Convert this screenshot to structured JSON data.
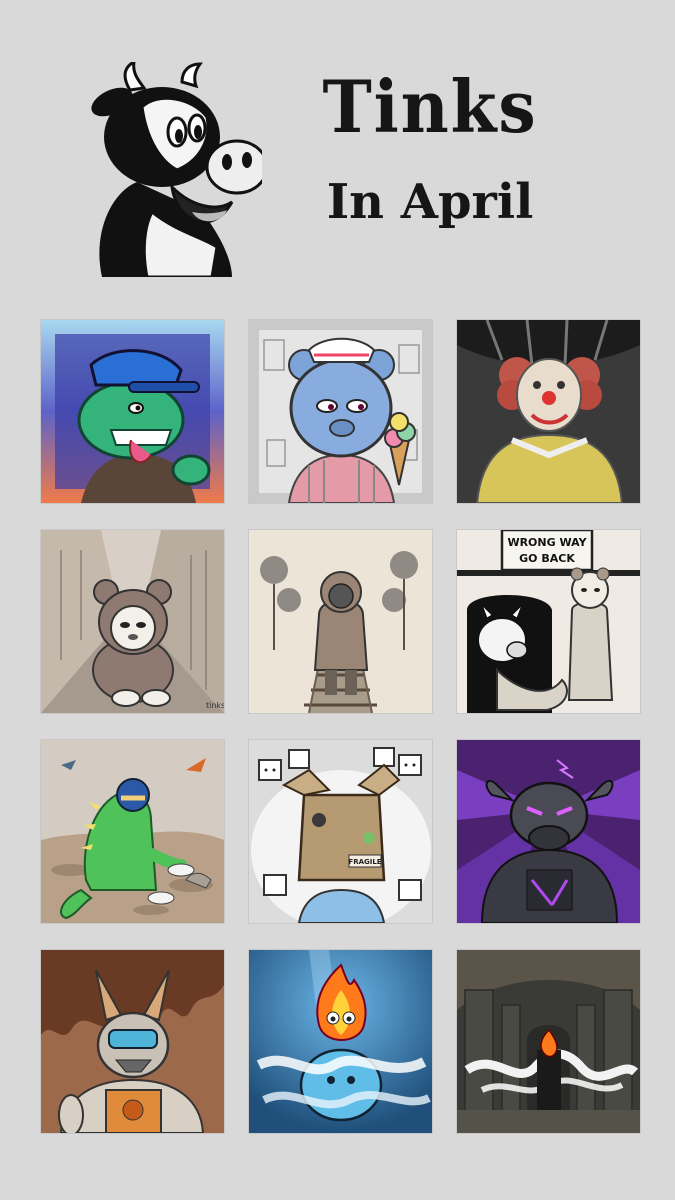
{
  "header": {
    "title": "Tinks",
    "subtitle": "In April"
  },
  "gallery": {
    "artworks": [
      {
        "subject": "green-dinosaur-blue-cap-icon"
      },
      {
        "subject": "blue-bear-ice-cream-icon"
      },
      {
        "subject": "clown-icon"
      },
      {
        "subject": "bear-hoodie-alley-icon"
      },
      {
        "subject": "hooded-figure-railroad-icon"
      },
      {
        "subject": "wrong-way-go-back-icon",
        "sign_text": "WRONG WAY GO BACK"
      },
      {
        "subject": "dinosaur-costume-desert-icon"
      },
      {
        "subject": "box-head-figure-icon",
        "box_label": "FRAGILE"
      },
      {
        "subject": "robot-bull-purple-icon"
      },
      {
        "subject": "rabbit-astronaut-icon"
      },
      {
        "subject": "fire-spirit-icon"
      },
      {
        "subject": "fire-spirit-cathedral-icon"
      }
    ]
  },
  "colors": {
    "background": "#d9d9d9",
    "ink": "#161616"
  }
}
